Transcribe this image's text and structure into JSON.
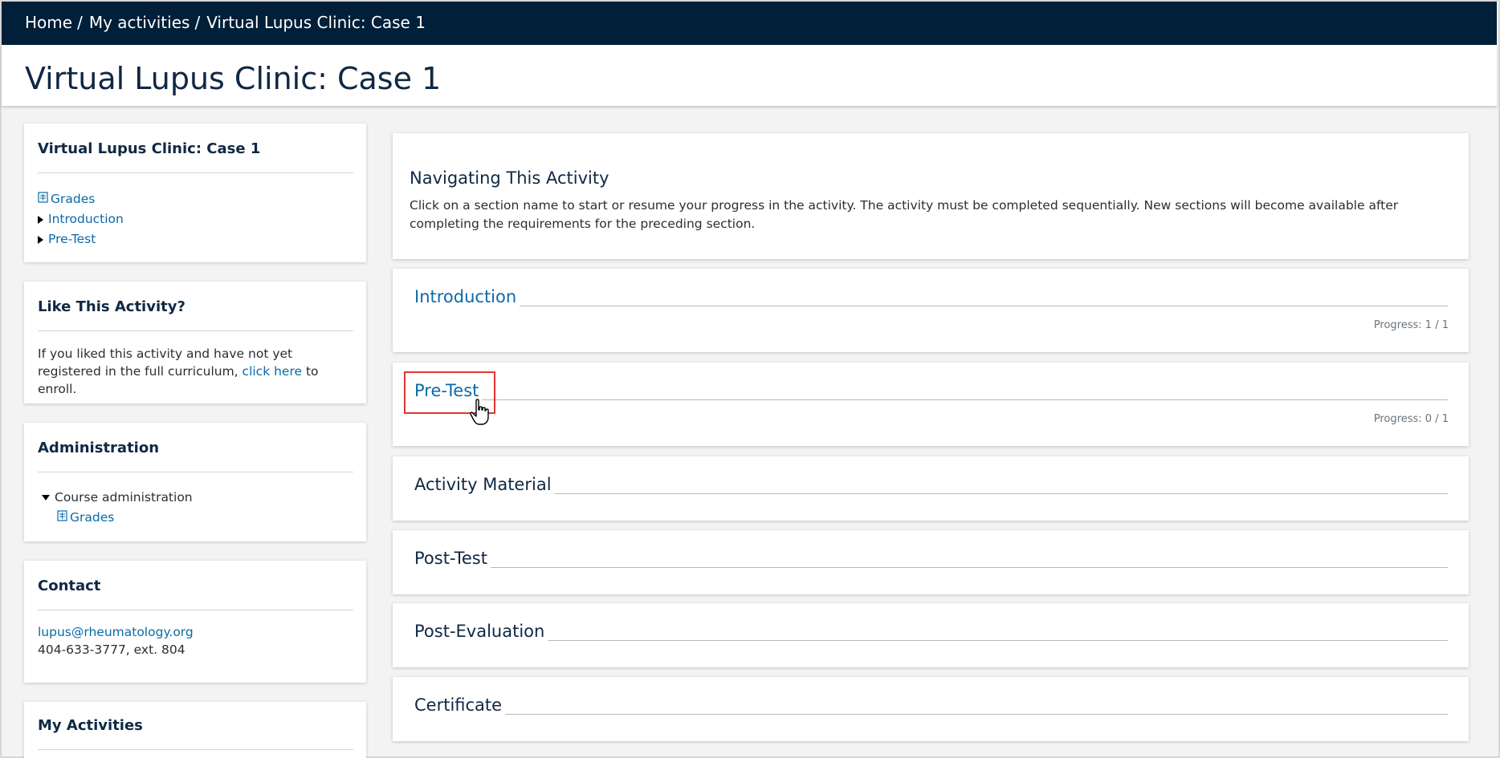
{
  "breadcrumb": [
    "Home",
    "My activities",
    "Virtual Lupus Clinic: Case 1"
  ],
  "page_title": "Virtual Lupus Clinic: Case 1",
  "sidebar": {
    "nav_block": {
      "title": "Virtual Lupus Clinic: Case 1",
      "items": [
        "Grades",
        "Introduction",
        "Pre-Test"
      ]
    },
    "like_block": {
      "title": "Like This Activity?",
      "text_before": "If you liked this activity and have not yet registered in the full curriculum,",
      "link": "click here",
      "text_after": "to enroll."
    },
    "admin_block": {
      "title": "Administration",
      "course_admin": "Course administration",
      "grades": "Grades"
    },
    "contact_block": {
      "title": "Contact",
      "email": "lupus@rheumatology.org",
      "phone": "404-633-3777, ext. 804"
    },
    "activities_block": {
      "title": "My Activities"
    }
  },
  "main": {
    "intro": {
      "title": "Navigating This Activity",
      "text": "Click on a section name to start or resume your progress in the activity. The activity must be completed sequentially. New sections will become available after completing the requirements for the preceding section."
    },
    "sections": [
      {
        "title": "Introduction",
        "progress": "Progress: 1 / 1"
      },
      {
        "title": "Pre-Test",
        "progress": "Progress: 0 / 1"
      },
      {
        "title": "Activity Material"
      },
      {
        "title": "Post-Test"
      },
      {
        "title": "Post-Evaluation"
      },
      {
        "title": "Certificate"
      }
    ]
  },
  "colors": {
    "header_bg": "#001f38",
    "link": "#0a6aa8",
    "heading": "#0f2844",
    "highlight": "#e1352e"
  }
}
